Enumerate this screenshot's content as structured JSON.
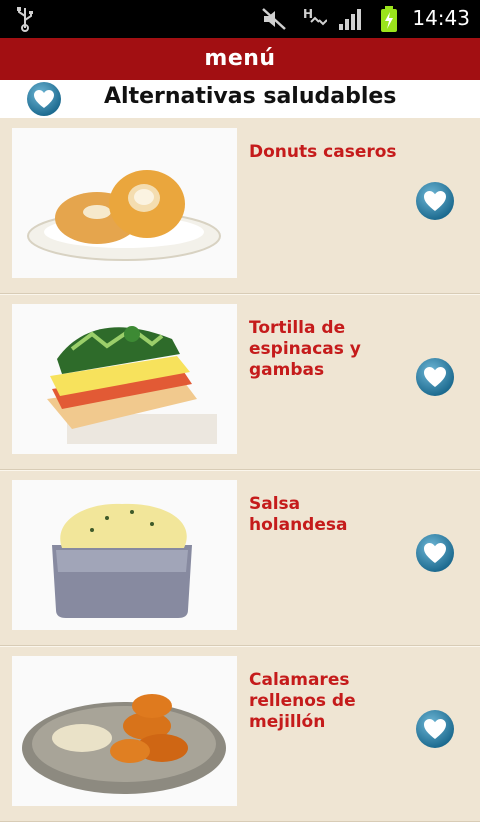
{
  "status_bar": {
    "time": "14:43",
    "icons": [
      "usb-icon",
      "mute-icon",
      "hspa-icon",
      "signal-icon",
      "battery-charging-icon"
    ]
  },
  "app_bar": {
    "title": "menú"
  },
  "section": {
    "title": "Alternativas saludables",
    "icon": "heart-icon"
  },
  "recipes": [
    {
      "name": "Donuts caseros",
      "image": "donuts-photo"
    },
    {
      "name": "Tortilla de espinacas y gambas",
      "image": "tortilla-photo"
    },
    {
      "name": "Salsa holandesa",
      "image": "salsa-photo"
    },
    {
      "name": "Calamares rellenos de mejillón",
      "image": "calamares-photo"
    }
  ],
  "colors": {
    "app_bar": "#a20f12",
    "recipe_text": "#c51b1b",
    "background": "#efe5d3",
    "heart_button": "#2f86ad"
  }
}
